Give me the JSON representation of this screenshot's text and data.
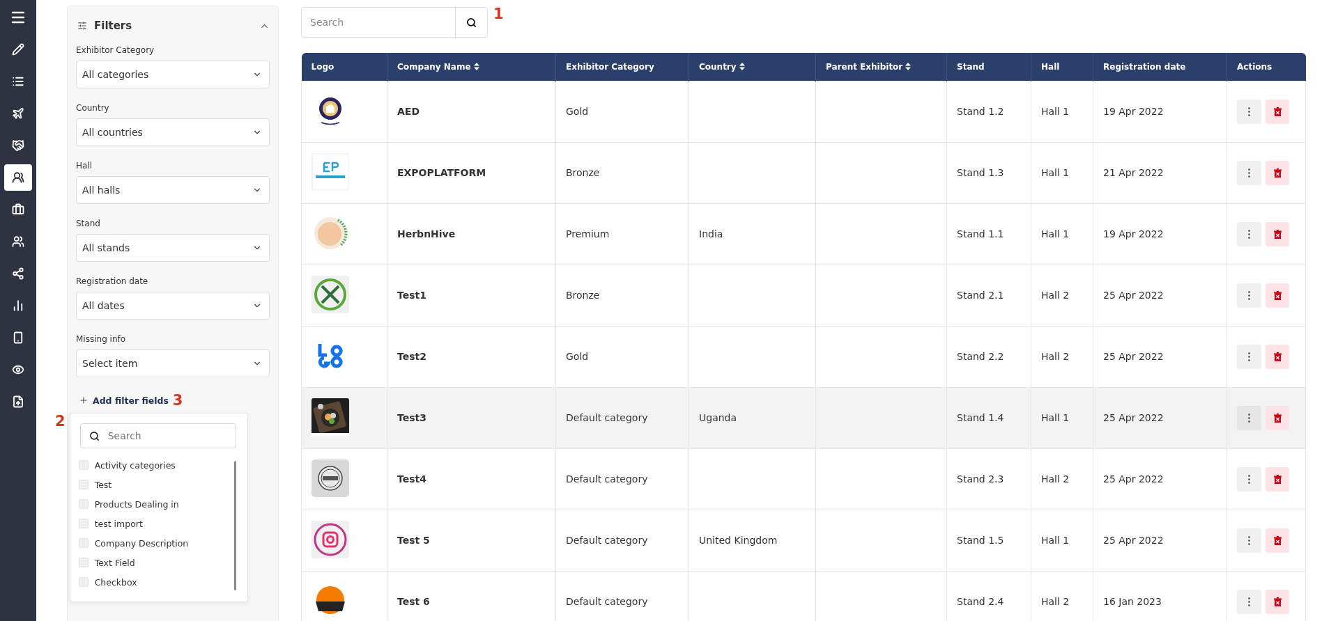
{
  "sidebar": {
    "items": [
      {
        "selected": false
      },
      {
        "selected": false
      },
      {
        "selected": false
      },
      {
        "selected": false
      },
      {
        "selected": false
      },
      {
        "selected": true
      },
      {
        "selected": false
      },
      {
        "selected": false
      },
      {
        "selected": false
      },
      {
        "selected": false
      },
      {
        "selected": false
      },
      {
        "selected": false
      },
      {
        "selected": false
      }
    ]
  },
  "filters": {
    "title": "Filters",
    "expanded": true,
    "fields": [
      {
        "label": "Exhibitor Category",
        "value": "All categories"
      },
      {
        "label": "Country",
        "value": "All countries"
      },
      {
        "label": "Hall",
        "value": "All halls"
      },
      {
        "label": "Stand",
        "value": "All stands"
      },
      {
        "label": "Registration date",
        "value": "All dates"
      },
      {
        "label": "Missing info",
        "value": "Select item"
      }
    ],
    "add_link": "Add filter fields",
    "add_marker": "3"
  },
  "field_picker": {
    "marker": "2",
    "search_placeholder": "Search",
    "items": [
      {
        "label": "Activity categories",
        "checked": false
      },
      {
        "label": "Test",
        "checked": false
      },
      {
        "label": "Products Dealing in",
        "checked": false
      },
      {
        "label": "test import",
        "checked": false
      },
      {
        "label": "Company Description",
        "checked": false
      },
      {
        "label": "Text Field",
        "checked": false
      },
      {
        "label": "Checkbox",
        "checked": false
      }
    ]
  },
  "search": {
    "placeholder": "Search",
    "marker": "1"
  },
  "table": {
    "columns": [
      {
        "label": "Logo",
        "sortable": false
      },
      {
        "label": "Company Name",
        "sortable": true
      },
      {
        "label": "Exhibitor Category",
        "sortable": false
      },
      {
        "label": "Country",
        "sortable": true
      },
      {
        "label": "Parent Exhibitor",
        "sortable": true
      },
      {
        "label": "Stand",
        "sortable": false
      },
      {
        "label": "Hall",
        "sortable": false
      },
      {
        "label": "Registration date",
        "sortable": false
      },
      {
        "label": "Actions",
        "sortable": false
      }
    ],
    "rows": [
      {
        "company": "AED",
        "category": "Gold",
        "stand": "Stand 1.2",
        "hall": "Hall 1",
        "date": "19 Apr 2022",
        "highlighted": false
      },
      {
        "company": "EXPOPLATFORM",
        "category": "Bronze",
        "stand": "Stand 1.3",
        "hall": "Hall 1",
        "date": "21 Apr 2022",
        "highlighted": false
      },
      {
        "company": "HerbnHive",
        "category": "Premium",
        "country": "India",
        "stand": "Stand 1.1",
        "hall": "Hall 1",
        "date": "19 Apr 2022",
        "highlighted": false
      },
      {
        "company": "Test1",
        "category": "Bronze",
        "stand": "Stand 2.1",
        "hall": "Hall 2",
        "date": "25 Apr 2022",
        "highlighted": false
      },
      {
        "company": "Test2",
        "category": "Gold",
        "stand": "Stand 2.2",
        "hall": "Hall 2",
        "date": "25 Apr 2022",
        "highlighted": false
      },
      {
        "company": "Test3",
        "category": "Default category",
        "country": "Uganda",
        "stand": "Stand 1.4",
        "hall": "Hall 1",
        "date": "25 Apr 2022",
        "highlighted": true
      },
      {
        "company": "Test4",
        "category": "Default category",
        "stand": "Stand 2.3",
        "hall": "Hall 2",
        "date": "25 Apr 2022",
        "highlighted": false
      },
      {
        "company": "Test 5",
        "category": "Default category",
        "country": "United Kingdom",
        "stand": "Stand 1.5",
        "hall": "Hall 1",
        "date": "25 Apr 2022",
        "highlighted": false
      },
      {
        "company": "Test 6",
        "category": "Default category",
        "stand": "Stand 2.4",
        "hall": "Hall 2",
        "date": "16 Jan 2023",
        "highlighted": false
      }
    ]
  }
}
